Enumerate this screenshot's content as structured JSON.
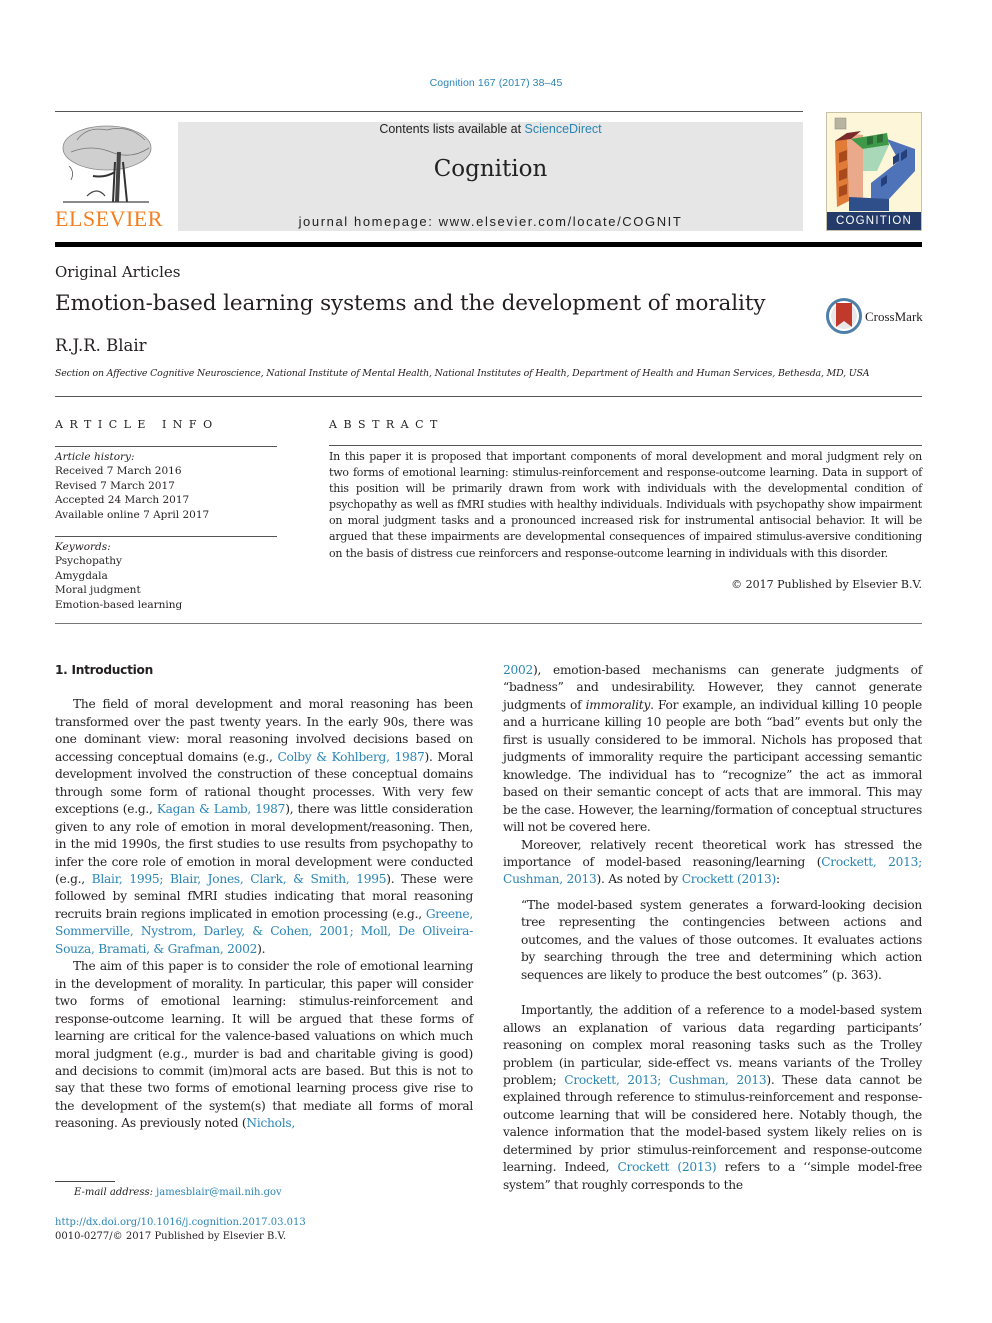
{
  "header": {
    "citation": "Cognition 167 (2017) 38–45",
    "contents_prefix": "Contents lists available at ",
    "contents_link": "ScienceDirect",
    "journal_title": "Cognition",
    "homepage": "journal homepage: www.elsevier.com/locate/COGNIT",
    "publisher_logo_text": "ELSEVIER",
    "cover_label": "COGNITION",
    "colors": {
      "link": "#2a85b5",
      "elsevier_orange": "#f47f20",
      "cover_navy": "#243a68",
      "masthead_gray": "#e6e6e6"
    }
  },
  "article": {
    "type": "Original Articles",
    "title": "Emotion-based learning systems and the development of morality",
    "crossmark_label": "CrossMark",
    "author": "R.J.R. Blair",
    "affiliation": "Section on Affective Cognitive Neuroscience, National Institute of Mental Health, National Institutes of Health, Department of Health and Human Services, Bethesda, MD, USA"
  },
  "article_info": {
    "heading": "ARTICLE INFO",
    "history_label": "Article history:",
    "history": [
      "Received 7 March 2016",
      "Revised 7 March 2017",
      "Accepted 24 March 2017",
      "Available online 7 April 2017"
    ],
    "keywords_label": "Keywords:",
    "keywords": [
      "Psychopathy",
      "Amygdala",
      "Moral judgment",
      "Emotion-based learning"
    ]
  },
  "abstract": {
    "heading": "ABSTRACT",
    "text": "In this paper it is proposed that important components of moral development and moral judgment rely on two forms of emotional learning: stimulus-reinforcement and response-outcome learning. Data in support of this position will be primarily drawn from work with individuals with the developmental condition of psychopathy as well as fMRI studies with healthy individuals. Individuals with psychopathy show impairment on moral judgment tasks and a pronounced increased risk for instrumental antisocial behavior. It will be argued that these impairments are developmental consequences of impaired stimulus-aversive conditioning on the basis of distress cue reinforcers and response-outcome learning in individuals with this disorder.",
    "copyright": "© 2017 Published by Elsevier B.V."
  },
  "body": {
    "section_heading": "1. Introduction",
    "p1": [
      "The field of moral development and moral reasoning has been transformed over the past twenty years. In the early 90s, there was one dominant view: moral reasoning involved decisions based on accessing conceptual domains (e.g., ",
      "Colby & Kohlberg, 1987",
      "). Moral development involved the construction of these conceptual domains through some form of rational thought processes. With very few exceptions (e.g., ",
      "Kagan & Lamb, 1987",
      "), there was little consideration given to any role of emotion in moral development/reasoning. Then, in the mid 1990s, the first studies to use results from psychopathy to infer the core role of emotion in moral development were conducted (e.g., ",
      "Blair, 1995; Blair, Jones, Clark, & Smith, 1995",
      "). These were followed by seminal fMRI studies indicating that moral reasoning recruits brain regions implicated in emotion processing (e.g., ",
      "Greene, Sommerville, Nystrom, Darley, & Cohen, 2001; Moll, De Oliveira-Souza, Bramati, & Grafman, 2002",
      ")."
    ],
    "p2": [
      "The aim of this paper is to consider the role of emotional learning in the development of morality. In particular, this paper will consider two forms of emotional learning: stimulus-reinforcement and response-outcome learning. It will be argued that these forms of learning are critical for the valence-based valuations on which much moral judgment (e.g., murder is bad and charitable giving is good) and decisions to commit (im)moral acts are based. But this is not to say that these two forms of emotional learning process give rise to the development of the system(s) that mediate all forms of moral reasoning. As previously noted (",
      "Nichols, 2002",
      "), emotion-based mechanisms can generate judgments of “badness” and undesirability. However, they cannot generate judgments of ",
      "immorality",
      ". For example, an individual killing 10 people and a hurricane killing 10 people are both “bad” events but only the first is usually considered to be immoral. Nichols has proposed that judgments of immorality require the participant accessing semantic knowledge. The individual has to “recognize” the act as immoral based on their semantic concept of acts that are immoral. This may be the case. However, the learning/formation of conceptual structures will not be covered here."
    ],
    "p3": [
      "Moreover, relatively recent theoretical work has stressed the importance of model-based reasoning/learning (",
      "Crockett, 2013; Cushman, 2013",
      "). As noted by ",
      "Crockett (2013)",
      ":"
    ],
    "quote": "“The model-based system generates a forward-looking decision tree representing the contingencies between actions and outcomes, and the values of those outcomes. It evaluates actions by searching through the tree and determining which action sequences are likely to produce the best outcomes” (p. 363).",
    "p4": [
      "Importantly, the addition of a reference to a model-based system allows an explanation of various data regarding participants’ reasoning on complex moral reasoning tasks such as the Trolley problem (in particular, side-effect vs. means variants of the Trolley problem; ",
      "Crockett, 2013; Cushman, 2013",
      "). These data cannot be explained through reference to stimulus-reinforcement and response-outcome learning that will be considered here. Notably though, the valence information that the model-based system likely relies on is determined by prior stimulus-reinforcement and response-outcome learning. Indeed, ",
      "Crockett (2013)",
      " refers to a ‘‘simple model-free system” that roughly corresponds to the"
    ]
  },
  "footer": {
    "email_label": "E-mail address: ",
    "email": "jamesblair@mail.nih.gov",
    "doi": "http://dx.doi.org/10.1016/j.cognition.2017.03.013",
    "issn": "0010-0277/© 2017 Published by Elsevier B.V."
  }
}
